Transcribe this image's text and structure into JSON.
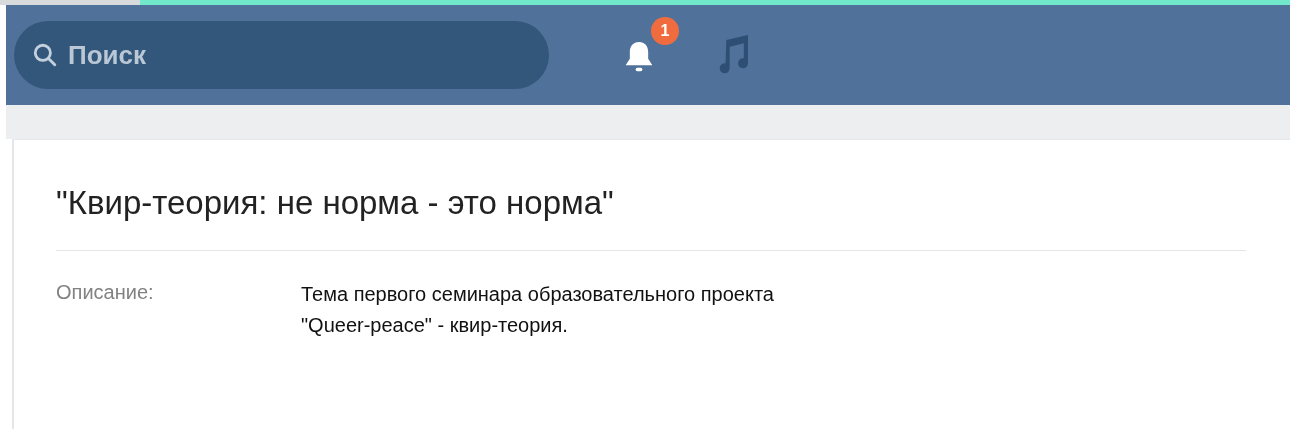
{
  "header": {
    "search": {
      "placeholder": "Поиск"
    },
    "notifications": {
      "badge": "1"
    }
  },
  "event": {
    "title": "\"Квир-теория: не норма - это норма\"",
    "fields": [
      {
        "label": "Описание:",
        "value": "Тема первого семинара образовательного проекта\n\"Queer-peace\" - квир-теория."
      }
    ]
  }
}
